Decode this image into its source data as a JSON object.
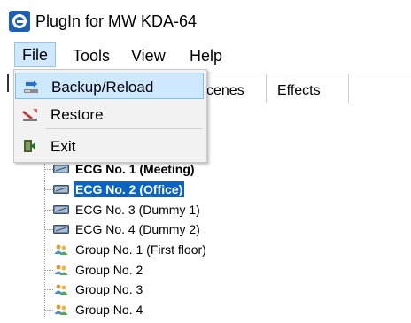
{
  "window": {
    "title": "PlugIn for MW KDA-64"
  },
  "menu": {
    "items": [
      {
        "label": "File",
        "active": true
      },
      {
        "label": "Tools"
      },
      {
        "label": "View"
      },
      {
        "label": "Help"
      }
    ]
  },
  "file_menu": {
    "items": [
      {
        "label": "Backup/Reload",
        "icon": "backup-reload-icon",
        "highlighted": true
      },
      {
        "label": "Restore",
        "icon": "restore-icon"
      },
      {
        "label": "Exit",
        "icon": "exit-icon"
      }
    ]
  },
  "tabs": {
    "partial_label": "cenes",
    "items": [
      {
        "label": "Effects"
      }
    ]
  },
  "tree": {
    "items": [
      {
        "label": "ECG No. 1 (Meeting)",
        "icon": "ecg-icon",
        "style": "bold"
      },
      {
        "label": "ECG No. 2 (Office)",
        "icon": "ecg-icon",
        "style": "selected"
      },
      {
        "label": "ECG No. 3 (Dummy 1)",
        "icon": "ecg-icon"
      },
      {
        "label": "ECG No. 4 (Dummy 2)",
        "icon": "ecg-icon"
      },
      {
        "label": "Group No. 1 (First floor)",
        "icon": "group-icon"
      },
      {
        "label": "Group No. 2",
        "icon": "group-icon"
      },
      {
        "label": "Group No. 3",
        "icon": "group-icon"
      },
      {
        "label": "Group No. 4",
        "icon": "group-icon"
      }
    ]
  },
  "colors": {
    "selection": "#0a64c8",
    "menu_highlight": "#cde8ff",
    "app_icon": "#1e5fb4"
  }
}
